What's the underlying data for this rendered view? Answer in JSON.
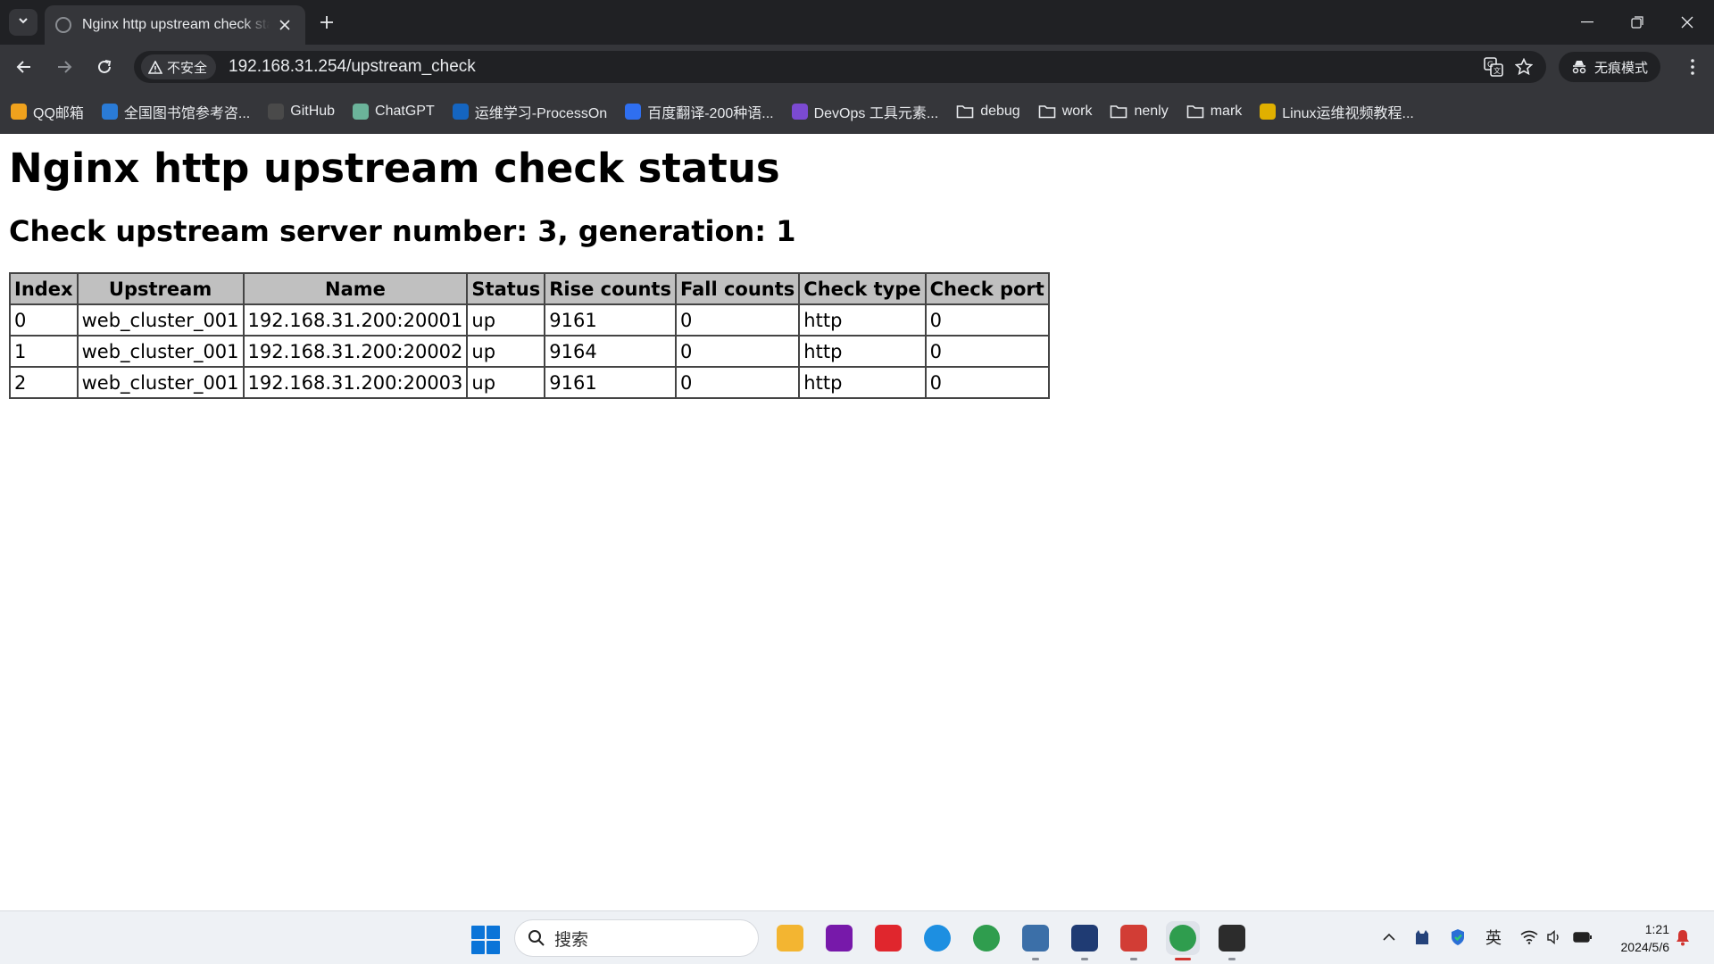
{
  "browser": {
    "tab": {
      "title": "Nginx http upstream check status"
    },
    "security_label": "不安全",
    "url": "192.168.31.254/upstream_check",
    "incognito_label": "无痕模式",
    "bookmarks": [
      {
        "label": "QQ邮箱",
        "icon": "qq-mail-icon",
        "color": "#f0a21d",
        "type": "site"
      },
      {
        "label": "全国图书馆参考咨...",
        "icon": "library-icon",
        "color": "#2a7bd6",
        "type": "site"
      },
      {
        "label": "GitHub",
        "icon": "github-icon",
        "color": "#4a4a4a",
        "type": "site"
      },
      {
        "label": "ChatGPT",
        "icon": "chatgpt-icon",
        "color": "#6bb39a",
        "type": "site"
      },
      {
        "label": "运维学习-ProcessOn",
        "icon": "processon-icon",
        "color": "#1565c0",
        "type": "site"
      },
      {
        "label": "百度翻译-200种语...",
        "icon": "baidu-translate-icon",
        "color": "#2f6ff0",
        "type": "site"
      },
      {
        "label": "DevOps 工具元素...",
        "icon": "devops-icon",
        "color": "#7b4ad1",
        "type": "site"
      },
      {
        "label": "debug",
        "icon": "folder-icon",
        "type": "folder"
      },
      {
        "label": "work",
        "icon": "folder-icon",
        "type": "folder"
      },
      {
        "label": "nenly",
        "icon": "folder-icon",
        "type": "folder"
      },
      {
        "label": "mark",
        "icon": "folder-icon",
        "type": "folder"
      },
      {
        "label": "Linux运维视频教程...",
        "icon": "linux-video-icon",
        "color": "#e0b000",
        "type": "site"
      }
    ]
  },
  "page": {
    "title": "Nginx http upstream check status",
    "subtitle": "Check upstream server number: 3, generation: 1",
    "table": {
      "headers": [
        "Index",
        "Upstream",
        "Name",
        "Status",
        "Rise counts",
        "Fall counts",
        "Check type",
        "Check port"
      ],
      "rows": [
        [
          "0",
          "web_cluster_001",
          "192.168.31.200:20001",
          "up",
          "9161",
          "0",
          "http",
          "0"
        ],
        [
          "1",
          "web_cluster_001",
          "192.168.31.200:20002",
          "up",
          "9164",
          "0",
          "http",
          "0"
        ],
        [
          "2",
          "web_cluster_001",
          "192.168.31.200:20003",
          "up",
          "9161",
          "0",
          "http",
          "0"
        ]
      ]
    }
  },
  "taskbar": {
    "search_placeholder": "搜索",
    "ime_label": "英",
    "time": "1:21",
    "date": "2024/5/6",
    "apps": [
      {
        "name": "file-explorer-icon",
        "color": "#f3b531",
        "running": false
      },
      {
        "name": "onenote-icon",
        "color": "#7719aa",
        "running": false
      },
      {
        "name": "screen-recorder-icon",
        "color": "#e0262d",
        "running": false
      },
      {
        "name": "edge-icon",
        "color": "#1d8fe1",
        "running": false
      },
      {
        "name": "chrome-icon",
        "color": "#2f9d4e",
        "running": false
      },
      {
        "name": "virtualbox-icon",
        "color": "#3b6fa8",
        "running": true
      },
      {
        "name": "cat-app-icon",
        "color": "#1f3b73",
        "running": true
      },
      {
        "name": "image-app-icon",
        "color": "#d23d35",
        "running": true
      },
      {
        "name": "chrome-icon",
        "color": "#2f9d4e",
        "running": true,
        "active": true
      },
      {
        "name": "terminal-icon",
        "color": "#2c2c2c",
        "running": true
      }
    ]
  }
}
